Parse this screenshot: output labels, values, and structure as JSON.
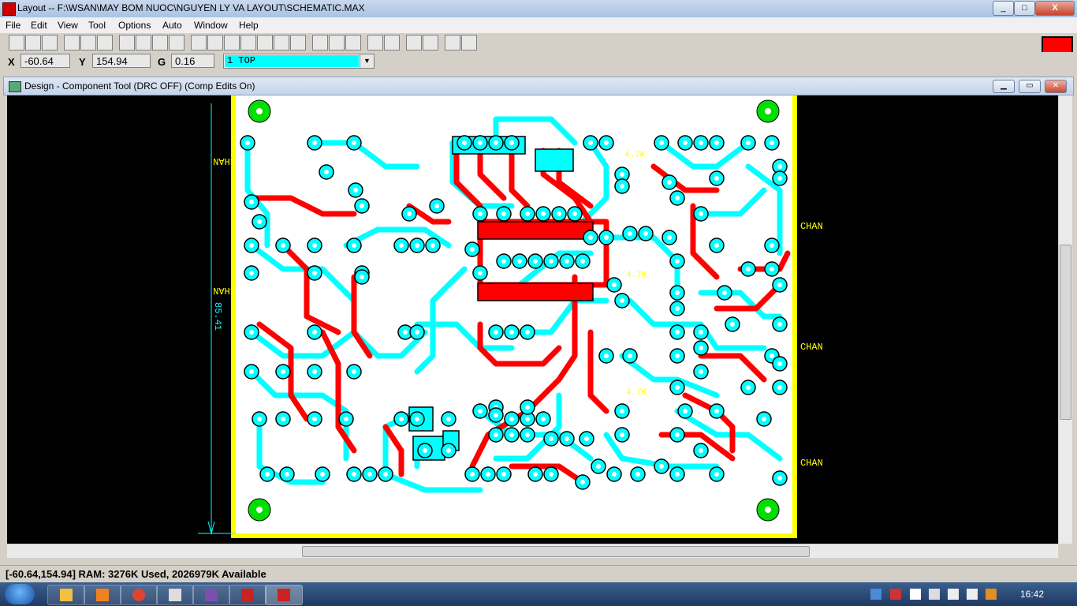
{
  "window": {
    "title": "Layout -- F:\\WSAN\\MAY BOM NUOC\\NGUYEN LY VA LAYOUT\\SCHEMATIC.MAX",
    "minimize": "_",
    "maximize": "□",
    "close": "X"
  },
  "menu": [
    "File",
    "Edit",
    "View",
    "Tool",
    "Options",
    "Auto",
    "Window",
    "Help"
  ],
  "coords": {
    "x_label": "X",
    "x_value": "-60.64",
    "y_label": "Y",
    "y_value": "154.94",
    "g_label": "G",
    "g_value": "0.16",
    "layer": "1 TOP"
  },
  "design_window": {
    "title": "Design - Component Tool (DRC OFF) (Comp Edits On)"
  },
  "canvas": {
    "labels": {
      "chan_left_1": "CHAN",
      "chan_left_2": "CHAN",
      "chan_right_1": "CHAN",
      "chan_right_2": "CHAN",
      "chan_right_3": "CHAN",
      "dimension": "85.41",
      "res_1": "4.7K",
      "res_2": "4.7K",
      "res_3": "4.7K"
    },
    "colors": {
      "board_outline": "#ffff00",
      "top_copper": "#ff0000",
      "bottom_copper": "#00ffff",
      "mounting_hole": "#00e000",
      "background": "#000000",
      "board": "#ffffff"
    }
  },
  "status": {
    "text": "[-60.64,154.94]    RAM: 3276K Used, 2026979K Available"
  },
  "taskbar": {
    "clock": "16:42"
  }
}
